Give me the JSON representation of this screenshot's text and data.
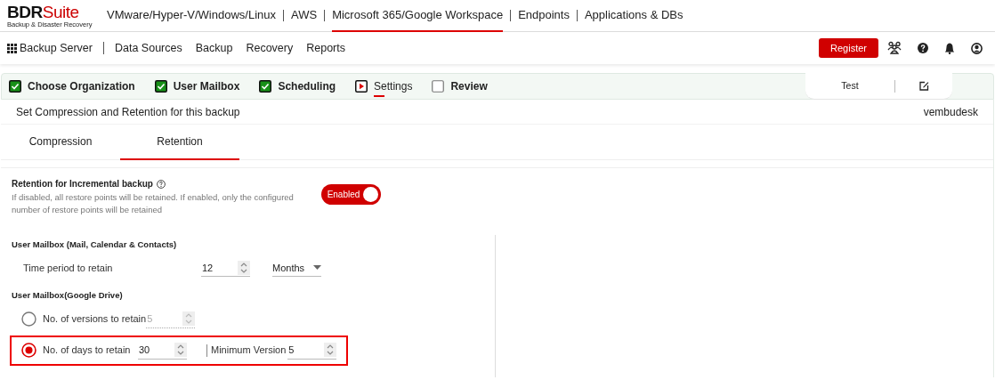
{
  "logo": {
    "brand_dark": "BDR",
    "brand_accent": "Suite",
    "tagline": "Backup & Disaster Recovery"
  },
  "top_nav": [
    {
      "label": "VMware/Hyper-V/Windows/Linux",
      "selected": false
    },
    {
      "label": "AWS",
      "selected": false
    },
    {
      "label": "Microsoft 365/Google Workspace",
      "selected": true
    },
    {
      "label": "Endpoints",
      "selected": false
    },
    {
      "label": "Applications & DBs",
      "selected": false
    }
  ],
  "sub_nav": {
    "home": "Backup Server",
    "items": [
      "Data Sources",
      "Backup",
      "Recovery",
      "Reports"
    ],
    "register": "Register"
  },
  "steps": [
    {
      "label": "Choose Organization",
      "kind": "done"
    },
    {
      "label": "User Mailbox",
      "kind": "done"
    },
    {
      "label": "Scheduling",
      "kind": "done"
    },
    {
      "label": "Settings",
      "kind": "current"
    },
    {
      "label": "Review",
      "kind": "pending"
    }
  ],
  "job_tab": {
    "label": "Test"
  },
  "header": {
    "title": "Set Compression and Retention for this backup",
    "user": "vembudesk"
  },
  "tabs": [
    {
      "label": "Compression",
      "selected": false
    },
    {
      "label": "Retention",
      "selected": true
    }
  ],
  "retention": {
    "title": "Retention for Incremental backup",
    "description": "If disabled, all restore points will be retained. If enabled, only the configured number of restore points will be retained",
    "toggle": {
      "label": "Enabled",
      "on": true
    }
  },
  "mail_section": {
    "heading": "User Mailbox (Mail, Calendar & Contacts)",
    "label": "Time period to retain",
    "value": "12",
    "unit": "Months"
  },
  "drive_section": {
    "heading": "User Mailbox(Google Drive)",
    "options": [
      {
        "label": "No. of versions to retain",
        "value": "5",
        "selected": false,
        "disabled": true
      },
      {
        "label": "No. of days to retain",
        "value": "30",
        "selected": true,
        "extra_label": "Minimum Version",
        "extra_value": "5"
      }
    ]
  }
}
